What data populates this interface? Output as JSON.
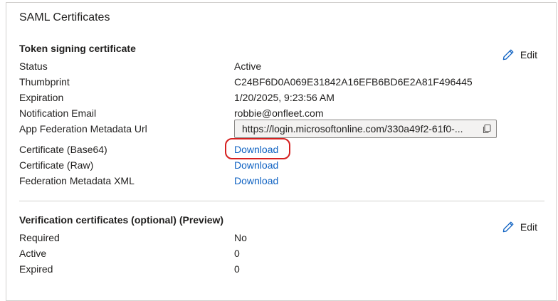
{
  "panel": {
    "title": "SAML Certificates"
  },
  "token_signing": {
    "title": "Token signing certificate",
    "edit_label": "Edit",
    "rows": {
      "status": {
        "label": "Status",
        "value": "Active"
      },
      "thumbprint": {
        "label": "Thumbprint",
        "value": "C24BF6D0A069E31842A16EFB6BD6E2A81F496445"
      },
      "expiration": {
        "label": "Expiration",
        "value": "1/20/2025, 9:23:56 AM"
      },
      "notification_email": {
        "label": "Notification Email",
        "value": "robbie@onfleet.com"
      },
      "metadata_url": {
        "label": "App Federation Metadata Url",
        "value": "https://login.microsoftonline.com/330a49f2-61f0-..."
      },
      "cert_base64": {
        "label": "Certificate (Base64)",
        "value": "Download"
      },
      "cert_raw": {
        "label": "Certificate (Raw)",
        "value": "Download"
      },
      "federation_xml": {
        "label": "Federation Metadata XML",
        "value": "Download"
      }
    }
  },
  "verification": {
    "title": "Verification certificates (optional) (Preview)",
    "edit_label": "Edit",
    "rows": {
      "required": {
        "label": "Required",
        "value": "No"
      },
      "active": {
        "label": "Active",
        "value": "0"
      },
      "expired": {
        "label": "Expired",
        "value": "0"
      }
    }
  },
  "icons": {
    "edit": "pencil-icon",
    "copy": "copy-icon"
  },
  "colors": {
    "link": "#0f62c2",
    "highlight": "#d62020",
    "border": "#d2d0ce"
  }
}
